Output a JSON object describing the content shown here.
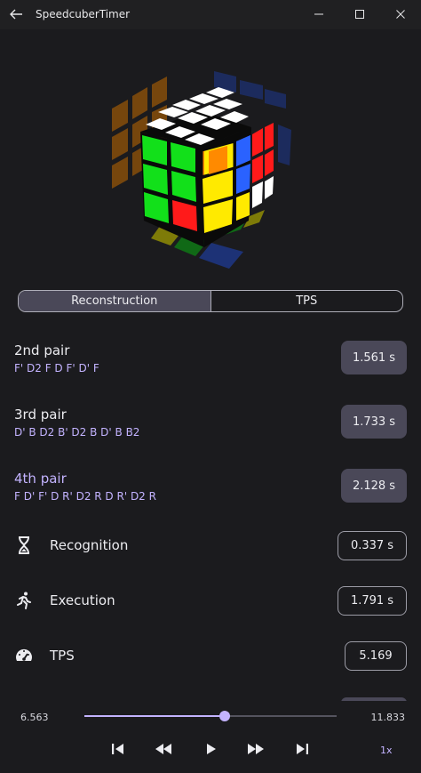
{
  "window": {
    "title": "SpeedcuberTimer",
    "back_icon": "back-arrow-icon",
    "minimize_icon": "minimize-icon",
    "maximize_icon": "maximize-icon",
    "close_icon": "close-icon"
  },
  "tabs": [
    {
      "label": "Reconstruction",
      "active": true
    },
    {
      "label": "TPS",
      "active": false
    }
  ],
  "steps": [
    {
      "title": "2nd pair",
      "moves": "F' D2 F D F' D' F",
      "time": "1.561 s",
      "highlighted": false
    },
    {
      "title": "3rd pair",
      "moves": "D' B D2 B' D2 B D' B B2",
      "time": "1.733 s",
      "highlighted": false
    },
    {
      "title": "4th pair",
      "moves": "F D' F' D R' D2 R D R' D2 R",
      "time": "2.128 s",
      "highlighted": true
    }
  ],
  "stats": [
    {
      "label": "Recognition",
      "value": "0.337 s",
      "icon": "hourglass-icon"
    },
    {
      "label": "Execution",
      "value": "1.791 s",
      "icon": "running-person-icon"
    },
    {
      "label": "TPS",
      "value": "5.169",
      "icon": "speedometer-icon"
    }
  ],
  "playback": {
    "position": "6.563",
    "total": "11.833",
    "progress": 0.5546,
    "speed": "1x",
    "icons": [
      "skip-previous-icon",
      "rewind-icon",
      "play-icon",
      "fast-forward-icon",
      "skip-next-icon"
    ]
  },
  "colors": {
    "accent": "#c3b3ff",
    "pill": "#4a4858",
    "background": "#1b1b1e",
    "cube_white": "#ffffff",
    "cube_green": "#12e01a",
    "cube_yellow": "#ffea00",
    "cube_orange": "#ff8a00",
    "cube_red": "#ff1a1a",
    "cube_blue": "#2a62ff"
  }
}
